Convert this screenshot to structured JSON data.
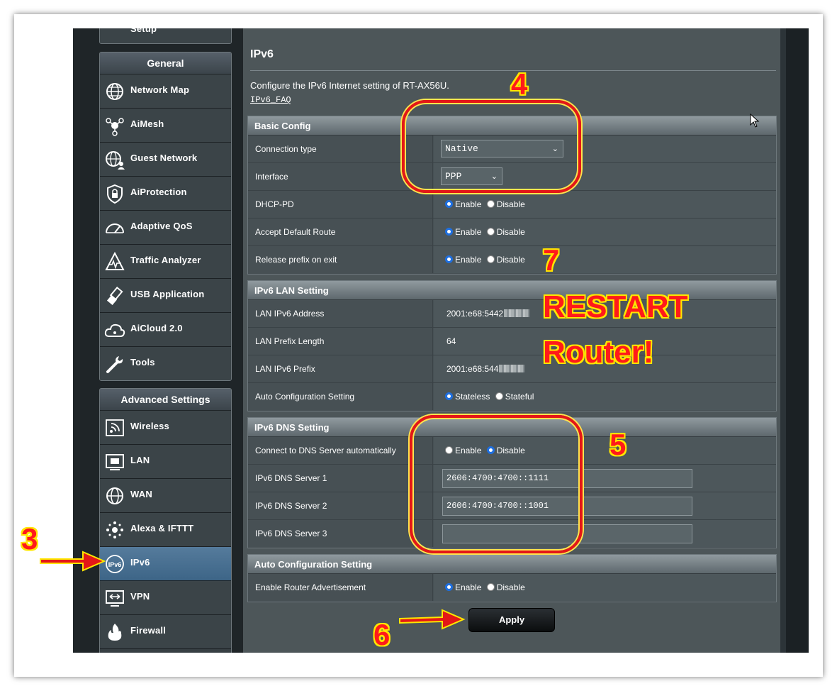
{
  "sidebar": {
    "top_partial_label": "Setup",
    "general_header": "General",
    "general_items": [
      {
        "label": "Network Map",
        "icon": "network-map-icon"
      },
      {
        "label": "AiMesh",
        "icon": "aimesh-icon"
      },
      {
        "label": "Guest Network",
        "icon": "guest-network-icon"
      },
      {
        "label": "AiProtection",
        "icon": "aiprotection-icon"
      },
      {
        "label": "Adaptive QoS",
        "icon": "adaptive-qos-icon"
      },
      {
        "label": "Traffic Analyzer",
        "icon": "traffic-analyzer-icon"
      },
      {
        "label": "USB Application",
        "icon": "usb-application-icon"
      },
      {
        "label": "AiCloud 2.0",
        "icon": "aicloud-icon"
      },
      {
        "label": "Tools",
        "icon": "tools-icon"
      }
    ],
    "advanced_header": "Advanced Settings",
    "advanced_items": [
      {
        "label": "Wireless",
        "icon": "wireless-icon"
      },
      {
        "label": "LAN",
        "icon": "lan-icon"
      },
      {
        "label": "WAN",
        "icon": "wan-icon"
      },
      {
        "label": "Alexa & IFTTT",
        "icon": "alexa-ifttt-icon"
      },
      {
        "label": "IPv6",
        "icon": "ipv6-icon",
        "active": true
      },
      {
        "label": "VPN",
        "icon": "vpn-icon"
      },
      {
        "label": "Firewall",
        "icon": "firewall-icon"
      }
    ]
  },
  "main": {
    "title": "IPv6",
    "description": "Configure the IPv6 Internet setting of RT-AX56U.",
    "faq_link": "IPv6_FAQ",
    "apply_label": "Apply"
  },
  "basic_config": {
    "header": "Basic Config",
    "connection_type_label": "Connection type",
    "connection_type_value": "Native",
    "interface_label": "Interface",
    "interface_value": "PPP",
    "dhcp_pd_label": "DHCP-PD",
    "accept_default_route_label": "Accept Default Route",
    "release_prefix_label": "Release prefix on exit",
    "enable_label": "Enable",
    "disable_label": "Disable"
  },
  "lan_setting": {
    "header": "IPv6 LAN Setting",
    "lan_address_label": "LAN IPv6 Address",
    "lan_address_value": "2001:e68:5442",
    "prefix_length_label": "LAN Prefix Length",
    "prefix_length_value": "64",
    "lan_prefix_label": "LAN IPv6 Prefix",
    "lan_prefix_value": "2001:e68:544",
    "auto_config_label": "Auto Configuration Setting",
    "stateless_label": "Stateless",
    "stateful_label": "Stateful"
  },
  "dns_setting": {
    "header": "IPv6 DNS Setting",
    "auto_dns_label": "Connect to DNS Server automatically",
    "dns1_label": "IPv6 DNS Server 1",
    "dns1_value": "2606:4700:4700::1111",
    "dns2_label": "IPv6 DNS Server 2",
    "dns2_value": "2606:4700:4700::1001",
    "dns3_label": "IPv6 DNS Server 3",
    "dns3_value": ""
  },
  "auto_config": {
    "header": "Auto Configuration Setting",
    "router_adv_label": "Enable Router Advertisement"
  },
  "annotations": {
    "step3": "3",
    "step4": "4",
    "step5": "5",
    "step6": "6",
    "step7": "7",
    "restart_line1": "RESTART",
    "restart_line2": "Router!"
  },
  "colors": {
    "accent_blue": "#1e6fe0",
    "annotation_red": "#e41717",
    "annotation_yellow": "#ffe600",
    "active_menu": "#4a7496"
  }
}
